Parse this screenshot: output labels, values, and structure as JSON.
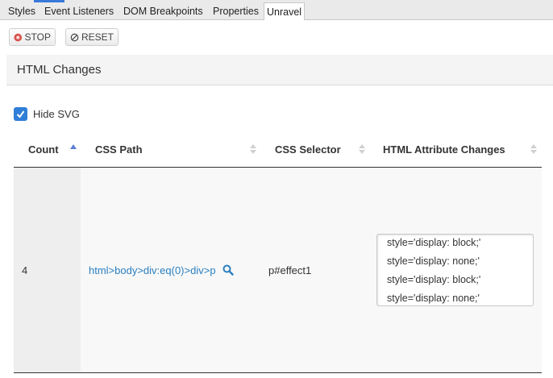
{
  "tabs": [
    {
      "label": "Styles"
    },
    {
      "label": "Event Listeners"
    },
    {
      "label": "DOM Breakpoints"
    },
    {
      "label": "Properties"
    },
    {
      "label": "Unravel"
    }
  ],
  "toolbar": {
    "stop_label": "STOP",
    "reset_label": "RESET",
    "stop_icon": "stop-circle-icon",
    "reset_icon": "prohibited-icon"
  },
  "panel": {
    "title": "HTML Changes"
  },
  "filter": {
    "hide_svg_label": "Hide SVG",
    "hide_svg_checked": true
  },
  "table": {
    "columns": [
      "Count",
      "CSS Path",
      "CSS Selector",
      "HTML Attribute Changes"
    ],
    "sorted_column": "Count",
    "rows": [
      {
        "count": "4",
        "css_path": "html>body>div:eq(0)>div>p",
        "css_selector": "p#effect1",
        "changes": [
          "style='display: block;'",
          "style='display: none;'",
          "style='display: block;'",
          "style='display: none;'"
        ]
      }
    ]
  },
  "colors": {
    "accent": "#2f7ed8",
    "link": "#2a7fc1",
    "stop_icon": "#d9534f"
  }
}
